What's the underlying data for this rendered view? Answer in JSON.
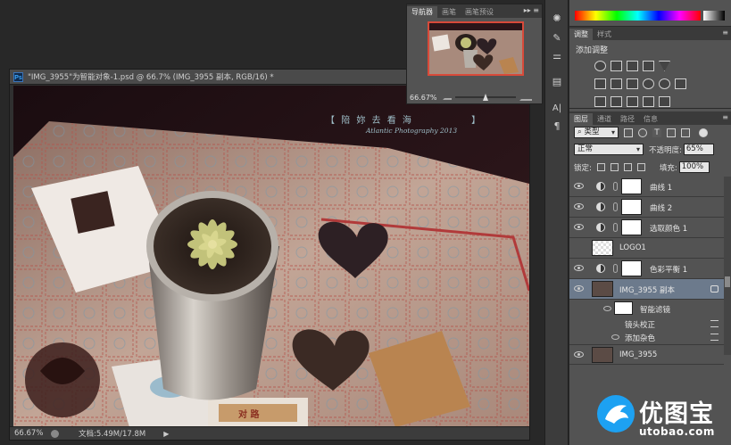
{
  "document": {
    "title": "\"IMG_3955\"为智能对象-1.psd @ 66.7% (IMG_3955 副本, RGB/16) *",
    "zoom": "66.67%",
    "doc_info": "文档:5.49M/17.8M",
    "photo_caption_left": "【",
    "photo_caption_chars": "陪 妳 去 看 海",
    "photo_caption_right": "】",
    "photo_signature": "Atlantic Photography 2013",
    "photo_sign_text": "对 路"
  },
  "navigator": {
    "tabs": [
      "导航器",
      "画笔",
      "画笔预设"
    ],
    "zoom": "66.67%",
    "zoom_level": 0.5
  },
  "adjustments": {
    "tabs": [
      "调整",
      "样式"
    ],
    "title": "添加调整"
  },
  "layers_panel": {
    "tabs": [
      "图层",
      "通道",
      "路径",
      "信息"
    ],
    "filter_label": "类型",
    "blend_mode": "正常",
    "opacity_label": "不透明度:",
    "opacity_value": "65%",
    "lock_label": "锁定:",
    "fill_label": "填充:",
    "fill_value": "100%",
    "layers": [
      {
        "name": "曲线 1",
        "kind": "adjustment"
      },
      {
        "name": "曲线 2",
        "kind": "adjustment"
      },
      {
        "name": "选取颜色 1",
        "kind": "adjustment"
      },
      {
        "name": "LOGO1",
        "kind": "pixel-transparent"
      },
      {
        "name": "色彩平衡 1",
        "kind": "adjustment"
      },
      {
        "name": "IMG_3955 副本",
        "kind": "smart-object",
        "selected": true
      },
      {
        "name": "智能滤镜",
        "kind": "smart-filter"
      },
      {
        "name": "镜头校正",
        "kind": "filter"
      },
      {
        "name": "添加杂色",
        "kind": "filter"
      },
      {
        "name": "IMG_3955",
        "kind": "photo"
      }
    ]
  },
  "watermark": {
    "text": "优图宝",
    "url": "utobao.com"
  },
  "colors": {
    "panel_bg": "#535353",
    "dark_bg": "#282828",
    "selected_layer": "#6c7a8c",
    "nav_frame": "#d84a3a",
    "accent_blue": "#1da1f2"
  }
}
